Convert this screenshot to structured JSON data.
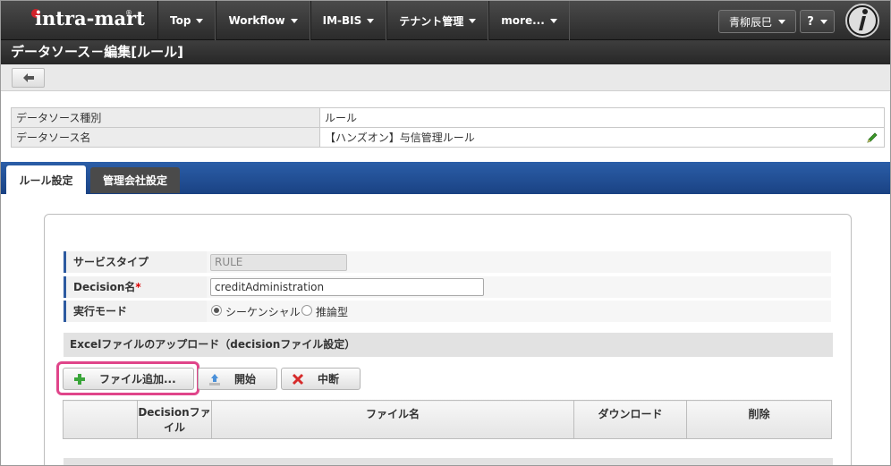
{
  "header": {
    "logo": "intra-mart",
    "nav": [
      "Top",
      "Workflow",
      "IM-BIS",
      "テナント管理",
      "more..."
    ],
    "user": "青柳辰巳",
    "help": "?"
  },
  "page": {
    "title": "データソース－編集[ルール]"
  },
  "info": {
    "type_label": "データソース種別",
    "type_value": "ルール",
    "name_label": "データソース名",
    "name_value": "【ハンズオン】与信管理ルール"
  },
  "tabs": [
    "ルール設定",
    "管理会社設定"
  ],
  "form": {
    "service_type_label": "サービスタイプ",
    "service_type_value": "RULE",
    "decision_label": "Decision名",
    "decision_required": "*",
    "decision_value": "creditAdministration",
    "mode_label": "実行モード",
    "mode_options": [
      "シーケンシャル",
      "推論型"
    ],
    "mode_selected": "シーケンシャル"
  },
  "upload": {
    "section_title": "Excelファイルのアップロード（decisionファイル設定）",
    "add_file_label": "ファイル追加...",
    "start_label": "開始",
    "stop_label": "中断",
    "columns": [
      "",
      "Decisionファイル",
      "ファイル名",
      "ダウンロード",
      "削除"
    ]
  },
  "colors": {
    "highlight": "#e0458a",
    "tabbar": "#1f4a8f",
    "accent_label": "#2d5aa0"
  }
}
